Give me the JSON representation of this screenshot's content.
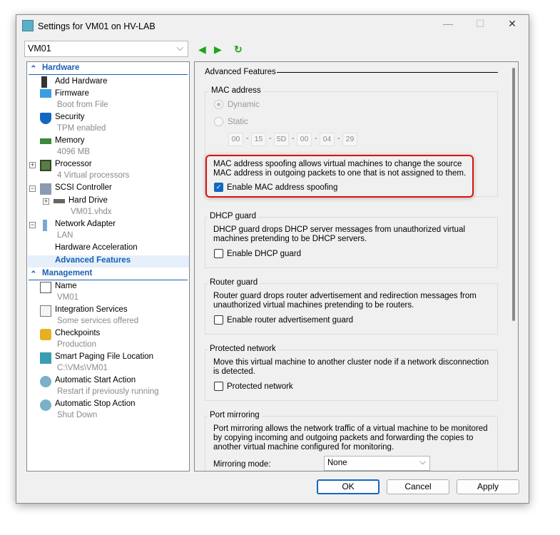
{
  "window": {
    "title": "Settings for VM01 on HV-LAB",
    "vm_selector": "VM01"
  },
  "tree": {
    "hardware_header": "Hardware",
    "management_header": "Management",
    "items": [
      {
        "label": "Add Hardware",
        "sub": ""
      },
      {
        "label": "Firmware",
        "sub": "Boot from File"
      },
      {
        "label": "Security",
        "sub": "TPM enabled"
      },
      {
        "label": "Memory",
        "sub": "4096 MB"
      },
      {
        "label": "Processor",
        "sub": "4 Virtual processors"
      },
      {
        "label": "SCSI Controller",
        "sub": ""
      },
      {
        "label": "Hard Drive",
        "sub": "VM01.vhdx"
      },
      {
        "label": "Network Adapter",
        "sub": "LAN"
      },
      {
        "label": "Hardware Acceleration",
        "sub": ""
      },
      {
        "label": "Advanced Features",
        "sub": ""
      },
      {
        "label": "Name",
        "sub": "VM01"
      },
      {
        "label": "Integration Services",
        "sub": "Some services offered"
      },
      {
        "label": "Checkpoints",
        "sub": "Production"
      },
      {
        "label": "Smart Paging File Location",
        "sub": "C:\\VMs\\VM01"
      },
      {
        "label": "Automatic Start Action",
        "sub": "Restart if previously running"
      },
      {
        "label": "Automatic Stop Action",
        "sub": "Shut Down"
      }
    ]
  },
  "panel": {
    "title": "Advanced Features",
    "mac": {
      "label": "MAC address",
      "dynamic": "Dynamic",
      "static": "Static",
      "octets": [
        "00",
        "15",
        "5D",
        "00",
        "04",
        "29"
      ],
      "spoof_text": "MAC address spoofing allows virtual machines to change the source MAC address in outgoing packets to one that is not assigned to them.",
      "spoof_label": "Enable MAC address spoofing",
      "spoof_checked": true
    },
    "dhcp": {
      "label": "DHCP guard",
      "text": "DHCP guard drops DHCP server messages from unauthorized virtual machines pretending to be DHCP servers.",
      "cb": "Enable DHCP guard"
    },
    "router": {
      "label": "Router guard",
      "text": "Router guard drops router advertisement and redirection messages from unauthorized virtual machines pretending to be routers.",
      "cb": "Enable router advertisement guard"
    },
    "protected": {
      "label": "Protected network",
      "text": "Move this virtual machine to another cluster node if a network disconnection is detected.",
      "cb": "Protected network"
    },
    "mirror": {
      "label": "Port mirroring",
      "text": "Port mirroring allows the network traffic of a virtual machine to be monitored by copying incoming and outgoing packets and forwarding the copies to another virtual machine configured for monitoring.",
      "mode_label": "Mirroring mode:",
      "mode_value": "None"
    }
  },
  "buttons": {
    "ok": "OK",
    "cancel": "Cancel",
    "apply": "Apply"
  },
  "colors": {
    "accent": "#1467c0",
    "highlight": "#e01010"
  }
}
